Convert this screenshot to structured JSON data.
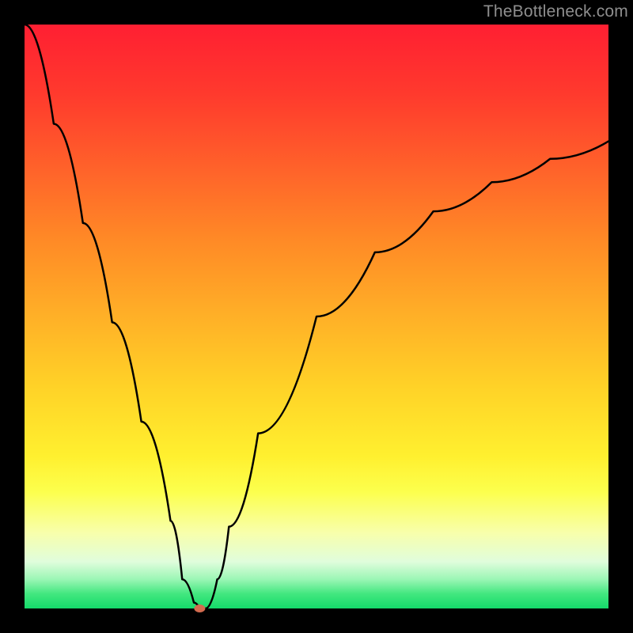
{
  "watermark": "TheBottleneck.com",
  "chart_data": {
    "type": "line",
    "title": "",
    "xlabel": "",
    "ylabel": "",
    "xlim": [
      0,
      100
    ],
    "ylim": [
      0,
      100
    ],
    "grid": false,
    "legend": false,
    "background_gradient": {
      "top": "#ff1f32",
      "mid": "#ffd227",
      "bottom": "#14da6a"
    },
    "series": [
      {
        "name": "bottleneck-curve",
        "color": "#000000",
        "x": [
          0,
          5,
          10,
          15,
          20,
          25,
          27,
          29,
          30,
          31,
          33,
          35,
          40,
          50,
          60,
          70,
          80,
          90,
          100
        ],
        "values": [
          100,
          83,
          66,
          49,
          32,
          15,
          5,
          1,
          0,
          0,
          5,
          14,
          30,
          50,
          61,
          68,
          73,
          77,
          80
        ]
      }
    ],
    "marker": {
      "name": "optimal-point",
      "x": 30,
      "y": 0,
      "color": "#d36b4f",
      "shape": "ellipse"
    }
  }
}
